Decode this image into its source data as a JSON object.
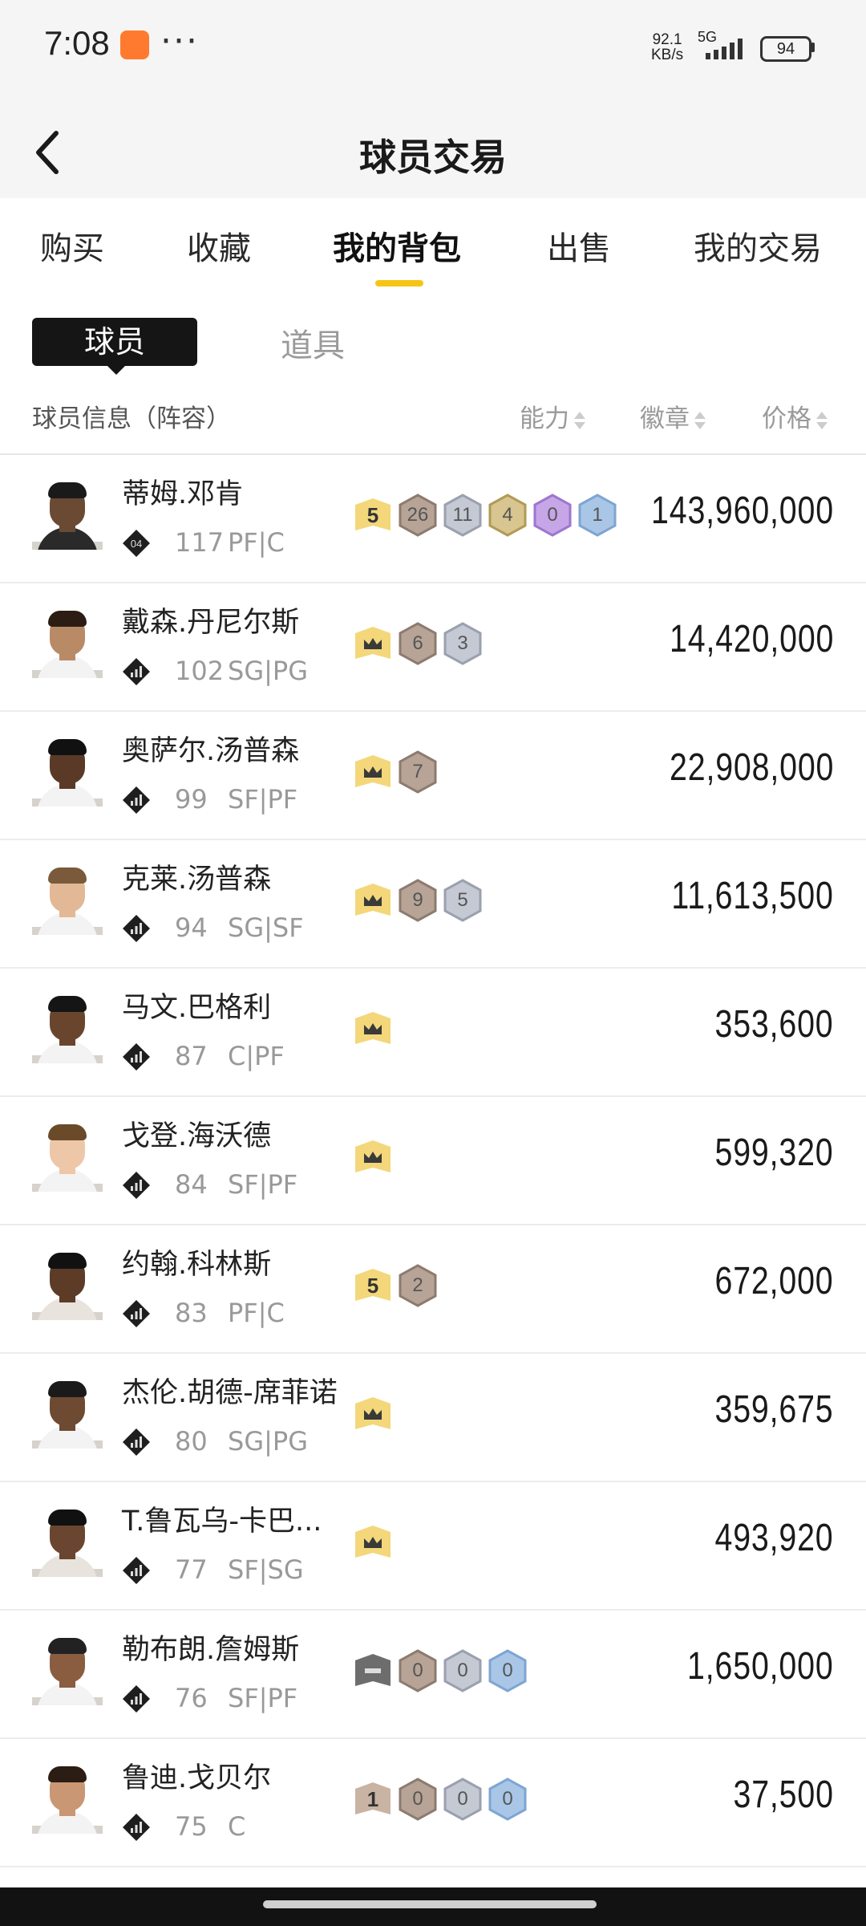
{
  "status": {
    "time": "7:08",
    "speed_value": "92.1",
    "speed_unit": "KB/s",
    "network": "5G",
    "battery": "94"
  },
  "header": {
    "title": "球员交易",
    "back_icon": "chevron-left-icon"
  },
  "tabs": [
    {
      "label": "购买"
    },
    {
      "label": "收藏"
    },
    {
      "label": "我的背包",
      "active": true
    },
    {
      "label": "出售"
    },
    {
      "label": "我的交易"
    }
  ],
  "subtabs": {
    "players": "球员",
    "props": "道具"
  },
  "columns": {
    "info": "球员信息（阵容）",
    "ability": "能力",
    "badge": "徽章",
    "price": "价格"
  },
  "players": [
    {
      "name": "蒂姆.邓肯",
      "ovr": "117",
      "position": "PF|C",
      "level_icon": "04",
      "badges": [
        {
          "type": "gold-level",
          "text": "5"
        },
        {
          "type": "bronze",
          "text": "26"
        },
        {
          "type": "silver",
          "text": "11"
        },
        {
          "type": "gold",
          "text": "4"
        },
        {
          "type": "purple",
          "text": "0"
        },
        {
          "type": "blue",
          "text": "1"
        }
      ],
      "price": "143,960,000"
    },
    {
      "name": "戴森.丹尼尔斯",
      "ovr": "102",
      "position": "SG|PG",
      "badges": [
        {
          "type": "crown"
        },
        {
          "type": "bronze",
          "text": "6"
        },
        {
          "type": "silver",
          "text": "3"
        }
      ],
      "price": "14,420,000"
    },
    {
      "name": "奥萨尔.汤普森",
      "ovr": "99",
      "position": "SF|PF",
      "badges": [
        {
          "type": "crown"
        },
        {
          "type": "bronze",
          "text": "7"
        }
      ],
      "price": "22,908,000"
    },
    {
      "name": "克莱.汤普森",
      "ovr": "94",
      "position": "SG|SF",
      "badges": [
        {
          "type": "crown"
        },
        {
          "type": "bronze",
          "text": "9"
        },
        {
          "type": "silver",
          "text": "5"
        }
      ],
      "price": "11,613,500"
    },
    {
      "name": "马文.巴格利",
      "ovr": "87",
      "position": "C|PF",
      "badges": [
        {
          "type": "crown"
        }
      ],
      "price": "353,600"
    },
    {
      "name": "戈登.海沃德",
      "ovr": "84",
      "position": "SF|PF",
      "badges": [
        {
          "type": "crown"
        }
      ],
      "price": "599,320"
    },
    {
      "name": "约翰.科林斯",
      "ovr": "83",
      "position": "PF|C",
      "badges": [
        {
          "type": "gold-level",
          "text": "5"
        },
        {
          "type": "bronze",
          "text": "2"
        }
      ],
      "price": "672,000"
    },
    {
      "name": "杰伦.胡德-席菲诺",
      "ovr": "80",
      "position": "SG|PG",
      "badges": [
        {
          "type": "crown"
        }
      ],
      "price": "359,675"
    },
    {
      "name": "T.鲁瓦乌-卡巴...",
      "ovr": "77",
      "position": "SF|SG",
      "badges": [
        {
          "type": "crown"
        }
      ],
      "price": "493,920"
    },
    {
      "name": "勒布朗.詹姆斯",
      "ovr": "76",
      "position": "SF|PF",
      "badges": [
        {
          "type": "dark-level"
        },
        {
          "type": "bronze",
          "text": "0"
        },
        {
          "type": "silver",
          "text": "0"
        },
        {
          "type": "blue",
          "text": "0"
        }
      ],
      "price": "1,650,000"
    },
    {
      "name": "鲁迪.戈贝尔",
      "ovr": "75",
      "position": "C",
      "badges": [
        {
          "type": "bronze-level",
          "text": "1"
        },
        {
          "type": "bronze",
          "text": "0"
        },
        {
          "type": "silver",
          "text": "0"
        },
        {
          "type": "blue",
          "text": "0"
        }
      ],
      "price": "37,500"
    }
  ]
}
